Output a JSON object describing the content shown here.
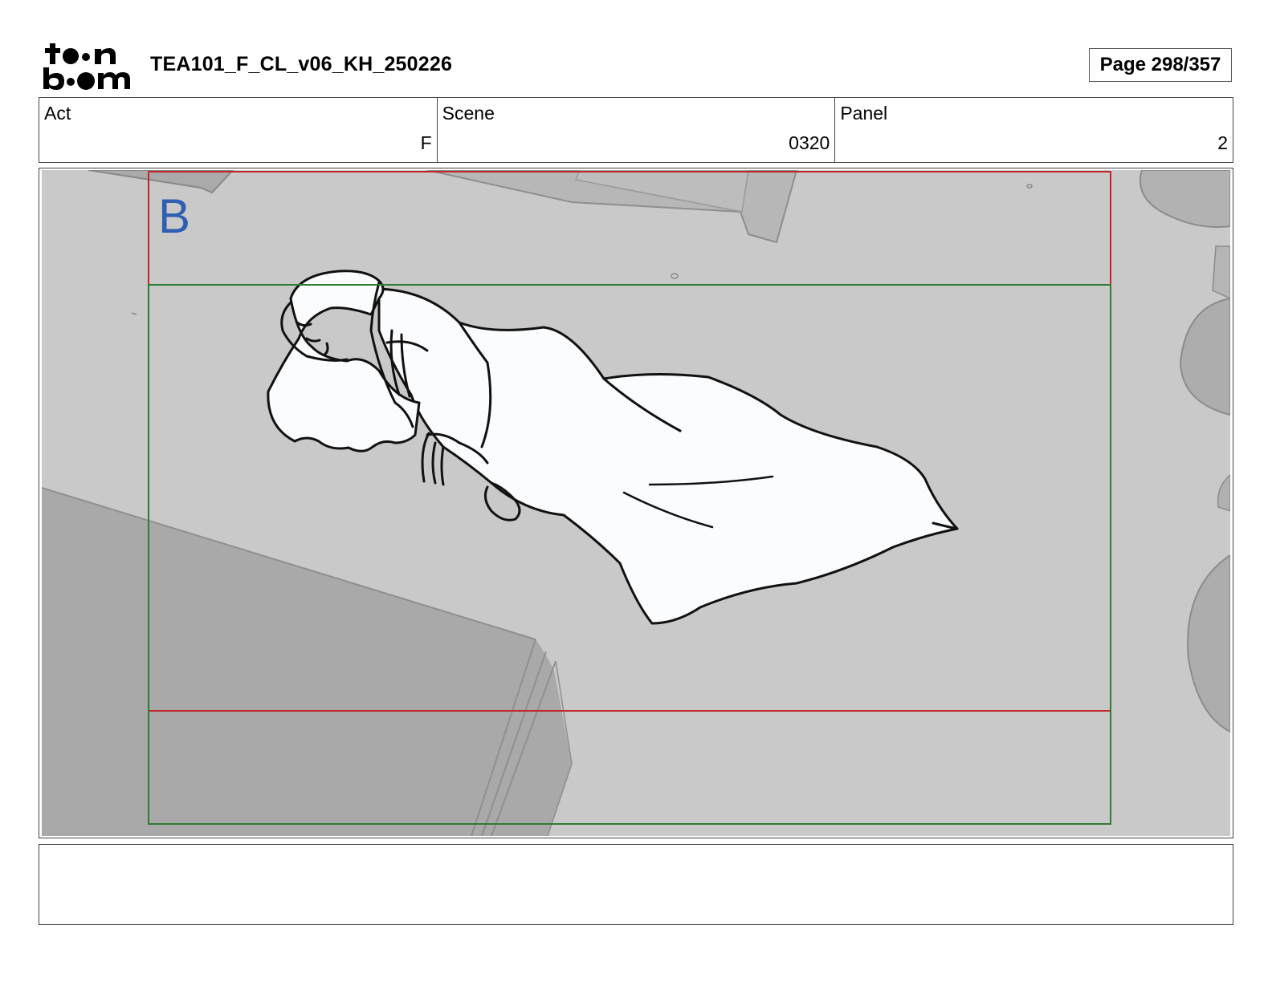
{
  "header": {
    "logo_text_top": "toon",
    "logo_text_bottom": "boom",
    "doc_title": "TEA101_F_CL_v06_KH_250226",
    "page_label": "Page 298/357"
  },
  "meta": {
    "act_label": "Act",
    "act_value": "F",
    "scene_label": "Scene",
    "scene_value": "0320",
    "panel_label": "Panel",
    "panel_value": "2"
  },
  "panel": {
    "layer_letter": "B",
    "frame_colors": {
      "camera_frame": "#c0262a",
      "safe_frame": "#2e7d32",
      "letter": "#2f5fb3"
    }
  },
  "notes": {
    "text": ""
  }
}
